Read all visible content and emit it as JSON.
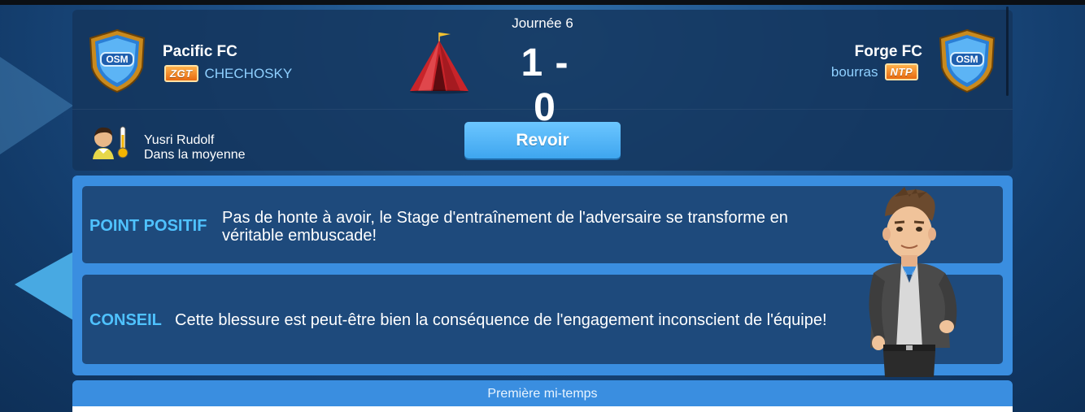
{
  "match": {
    "round": "Journée 6",
    "score": "1 - 0",
    "home": {
      "crest_text": "OSM",
      "name": "Pacific FC",
      "badge": "ZGT",
      "manager": "CHECHOSKY"
    },
    "away": {
      "crest_text": "OSM",
      "name": "Forge FC",
      "badge": "NTP",
      "manager": "bourras"
    },
    "tactic_icon": "tent-icon"
  },
  "player": {
    "name": "Yusri Rudolf",
    "form": "Dans la moyenne",
    "icon": "thermometer-icon"
  },
  "actions": {
    "replay_label": "Revoir"
  },
  "advice": {
    "positive_title": "POINT POSITIF",
    "positive_text": "Pas de honte à avoir, le Stage d'entraînement de l'adversaire se transforme en véritable embuscade!",
    "tip_title": "CONSEIL",
    "tip_text": "Cette blessure est peut-être bien la conséquence de l'engagement inconscient de l'équipe!"
  },
  "section": {
    "first_half": "Première mi-temps"
  },
  "colors": {
    "accent_blue": "#3a8ee0",
    "title_blue": "#4fc2ff",
    "badge_orange": "#f08a24"
  }
}
